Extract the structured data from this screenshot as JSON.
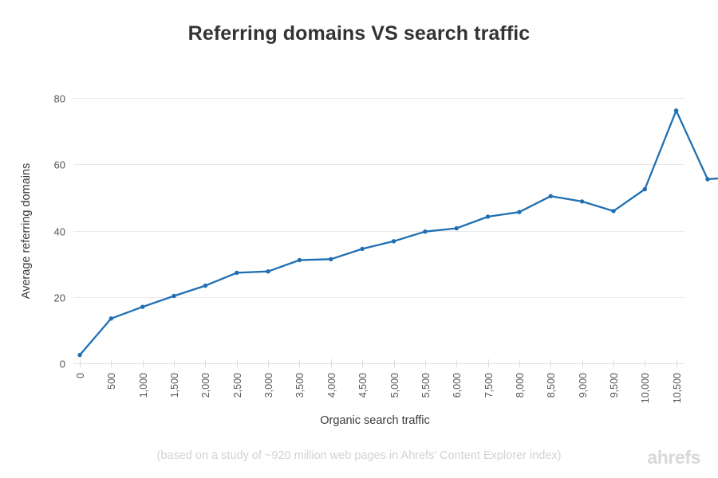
{
  "chart_data": {
    "type": "line",
    "title": "Referring domains VS search traffic",
    "xlabel": "Organic search traffic",
    "ylabel": "Average referring domains",
    "grid": true,
    "legend": false,
    "xtick_labels": [
      "0",
      "500",
      "1,000",
      "1,500",
      "2,000",
      "2,500",
      "3,000",
      "3,500",
      "4,000",
      "4,500",
      "5,000",
      "5,500",
      "6,000",
      "7,500",
      "8,000",
      "8,500",
      "9,000",
      "9,500",
      "10,000",
      "10,500"
    ],
    "ytick_labels": [
      "0",
      "20",
      "40",
      "60",
      "80"
    ],
    "yticks": [
      0,
      20,
      40,
      60,
      80
    ],
    "ylim": [
      0,
      84
    ],
    "x": [
      0,
      500,
      1000,
      1500,
      2000,
      2500,
      3000,
      3500,
      4000,
      4500,
      5000,
      5500,
      6000,
      7500,
      8000,
      8500,
      9000,
      9500,
      10000,
      10500
    ],
    "values": [
      2.5,
      13.5,
      17.0,
      20.3,
      23.4,
      27.3,
      27.7,
      31.1,
      31.4,
      34.5,
      36.8,
      39.7,
      40.7,
      44.2,
      45.6,
      50.4,
      48.8,
      45.9,
      52.5,
      76.2
    ],
    "series": [
      {
        "name": "Average referring domains",
        "color": "#1F6FB2",
        "values": [
          2.5,
          13.5,
          17.0,
          20.3,
          23.4,
          27.3,
          27.7,
          31.1,
          31.4,
          34.5,
          36.8,
          39.7,
          40.7,
          44.2,
          45.6,
          50.4,
          48.8,
          45.9,
          52.5,
          76.2,
          55.5,
          56.3
        ]
      }
    ],
    "points": [
      {
        "xlabel": "0",
        "y": 2.5
      },
      {
        "xlabel": "500",
        "y": 13.5
      },
      {
        "xlabel": "1,000",
        "y": 17.0
      },
      {
        "xlabel": "1,500",
        "y": 20.3
      },
      {
        "xlabel": "2,000",
        "y": 23.4
      },
      {
        "xlabel": "2,500",
        "y": 27.3
      },
      {
        "xlabel": "3,000",
        "y": 27.7
      },
      {
        "xlabel": "3,500",
        "y": 31.1
      },
      {
        "xlabel": "4,000",
        "y": 31.4
      },
      {
        "xlabel": "4,500",
        "y": 34.5
      },
      {
        "xlabel": "5,000",
        "y": 36.8
      },
      {
        "xlabel": "5,500",
        "y": 39.7
      },
      {
        "xlabel": "6,000",
        "y": 40.7
      },
      {
        "xlabel": "7,500",
        "y": 44.2
      },
      {
        "xlabel": "8,000",
        "y": 45.6
      },
      {
        "xlabel": "8,500",
        "y": 50.4
      },
      {
        "xlabel": "9,000",
        "y": 48.8
      },
      {
        "xlabel": "9,500",
        "y": 45.9
      },
      {
        "xlabel": "10,000",
        "y": 52.5
      },
      {
        "xlabel": "10,500",
        "y": 76.2
      }
    ],
    "extra_points": [
      {
        "y": 55.5
      },
      {
        "y": 56.3
      }
    ],
    "colors": {
      "line": "#1F6FB2",
      "marker": "#1F6FB2",
      "grid": "#e9e9e9",
      "title_text": "#333333",
      "tick_text": "#555555",
      "footer_text": "#d2d2d2",
      "background": "#ffffff"
    }
  },
  "footer": {
    "note": "(based on a study of ~920 million web pages in Ahrefs' Content Explorer index)",
    "brand": "ahrefs"
  }
}
